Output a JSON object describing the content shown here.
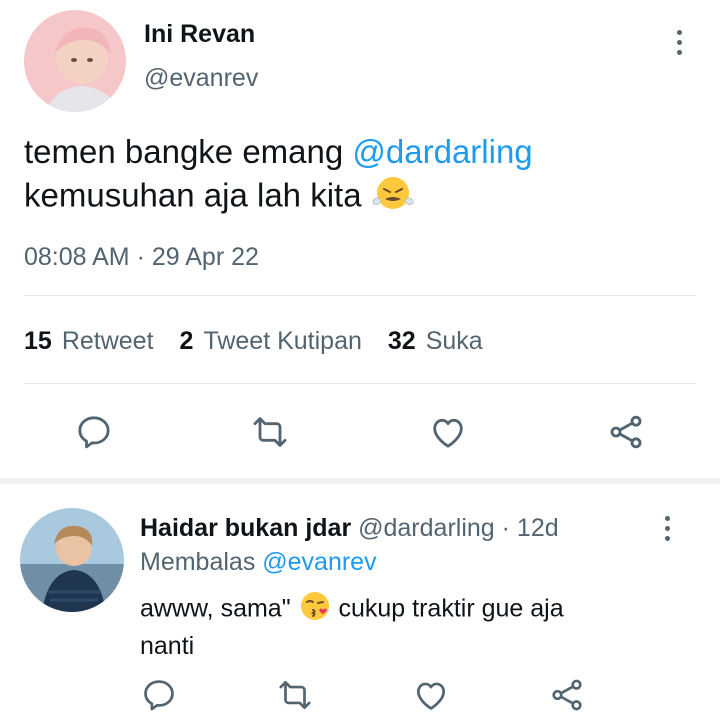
{
  "main_tweet": {
    "author_name": "Ini Revan",
    "author_handle": "@evanrev",
    "text_1": "temen bangke emang ",
    "mention": "@dardarling",
    "text_2": "kemusuhan aja lah kita ",
    "time": "08:08 AM",
    "dot": "·",
    "date": "29 Apr 22",
    "stats": {
      "retweet_count": "15",
      "retweet_label": "Retweet",
      "quote_count": "2",
      "quote_label": "Tweet Kutipan",
      "like_count": "32",
      "like_label": "Suka"
    }
  },
  "reply": {
    "author_name": "Haidar bukan jdar",
    "author_handle": "@dardarling",
    "dot": "·",
    "age": "12d",
    "replying_prefix": "Membalas ",
    "replying_to": "@evanrev",
    "text_1": "awww, sama\" ",
    "text_2": " cukup traktir gue aja",
    "text_3": "nanti"
  },
  "colors": {
    "accent": "#1d9bf0",
    "secondary_text": "#536471",
    "primary_text": "#0f1419"
  },
  "icons": [
    "more-vertical-icon",
    "reply-icon",
    "retweet-icon",
    "like-icon",
    "share-icon",
    "face-steam-emoji",
    "kiss-emoji"
  ]
}
